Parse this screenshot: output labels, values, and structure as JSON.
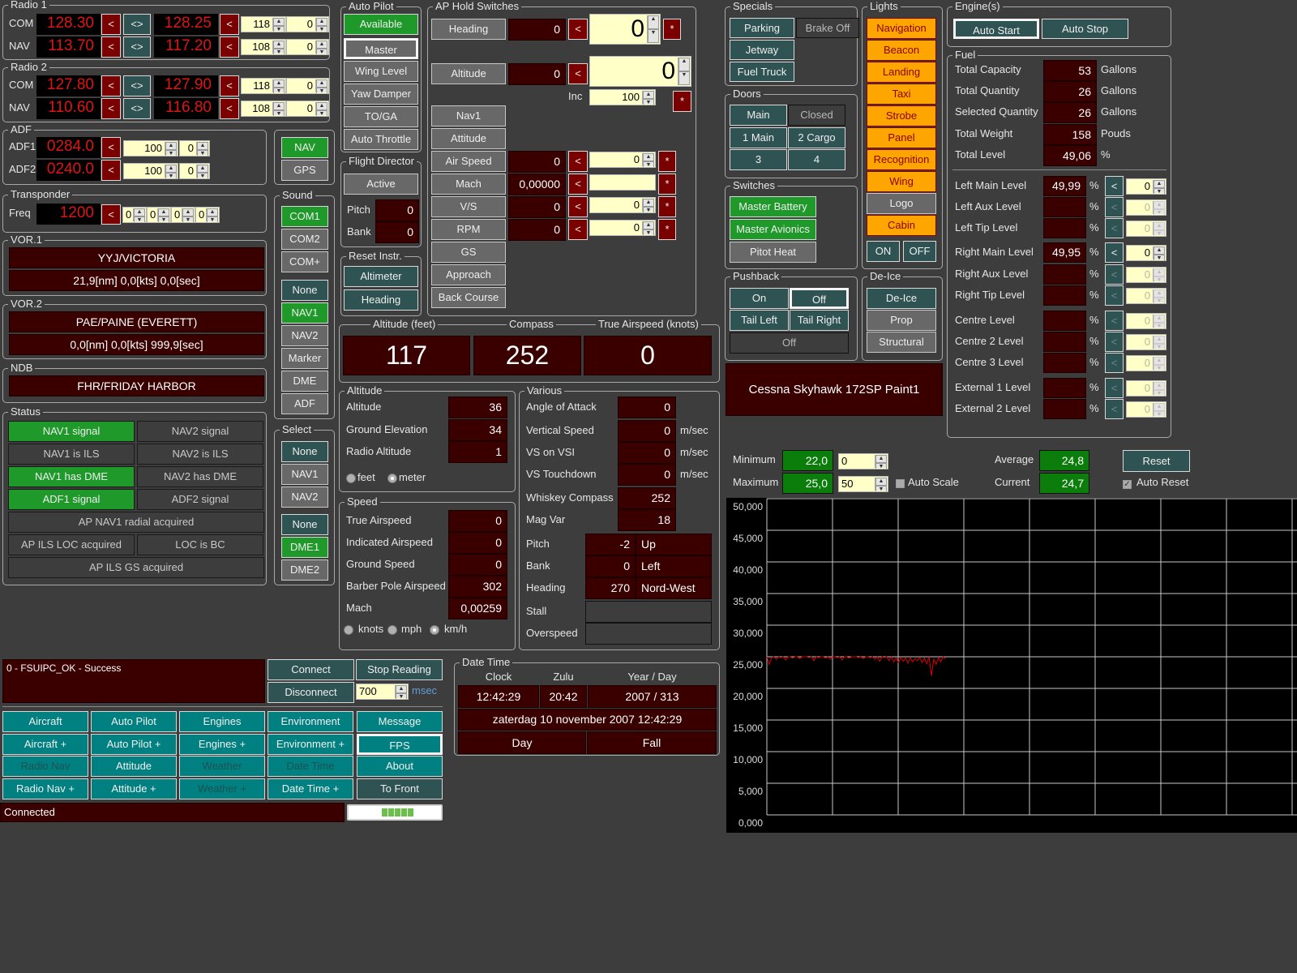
{
  "buttons": {
    "transfer": "<",
    "swap": "<>",
    "set": "*"
  },
  "radio1": {
    "title": "Radio 1",
    "com": {
      "label": "COM",
      "active": "128.30",
      "standby": "128.25",
      "spin_mhz": "118",
      "spin_khz": "0"
    },
    "nav": {
      "label": "NAV",
      "active": "113.70",
      "standby": "117.20",
      "spin_mhz": "108",
      "spin_khz": "0"
    }
  },
  "radio2": {
    "title": "Radio 2",
    "com": {
      "label": "COM",
      "active": "127.80",
      "standby": "127.90",
      "spin_mhz": "118",
      "spin_khz": "0"
    },
    "nav": {
      "label": "NAV",
      "active": "110.60",
      "standby": "116.80",
      "spin_mhz": "108",
      "spin_khz": "0"
    }
  },
  "adf": {
    "title": "ADF",
    "adf1": {
      "label": "ADF1",
      "value": "0284.0",
      "spin1": "100",
      "spin2": "0"
    },
    "adf2": {
      "label": "ADF2",
      "value": "0240.0",
      "spin1": "100",
      "spin2": "0"
    }
  },
  "navgps": {
    "nav": "NAV",
    "gps": "GPS",
    "selected": "NAV"
  },
  "transponder": {
    "title": "Transponder",
    "label": "Freq",
    "value": "1200",
    "digits": [
      "0",
      "0",
      "0",
      "0"
    ]
  },
  "vor1": {
    "title": "VOR.1",
    "ident": "YYJ/VICTORIA",
    "info": "21,9[nm] 0,0[kts] 0,0[sec]"
  },
  "vor2": {
    "title": "VOR.2",
    "ident": "PAE/PAINE (EVERETT)",
    "info": "0,0[nm] 0,0[kts] 999,9[sec]"
  },
  "ndb": {
    "title": "NDB",
    "ident": "FHR/FRIDAY HARBOR"
  },
  "status": {
    "title": "Status",
    "items": [
      {
        "label": "NAV1 signal",
        "on": true
      },
      {
        "label": "NAV2 signal",
        "on": false
      },
      {
        "label": "NAV1 is ILS",
        "on": false
      },
      {
        "label": "NAV2 is ILS",
        "on": false
      },
      {
        "label": "NAV1 has DME",
        "on": true
      },
      {
        "label": "NAV2 has DME",
        "on": false
      },
      {
        "label": "ADF1 signal",
        "on": true
      },
      {
        "label": "ADF2 signal",
        "on": false
      },
      {
        "label": "AP NAV1 radial acquired",
        "on": false
      },
      {
        "label": "AP ILS LOC acquired",
        "on": false
      },
      {
        "label": "LOC is BC",
        "on": false
      },
      {
        "label": "AP ILS GS acquired",
        "on": false
      }
    ]
  },
  "sound": {
    "title": "Sound",
    "items": [
      {
        "label": "COM1",
        "state": "on"
      },
      {
        "label": "COM2",
        "state": "off"
      },
      {
        "label": "COM+",
        "state": "off"
      },
      {
        "label": "None",
        "state": "none"
      },
      {
        "label": "NAV1",
        "state": "on"
      },
      {
        "label": "NAV2",
        "state": "off"
      },
      {
        "label": "Marker",
        "state": "off"
      },
      {
        "label": "DME",
        "state": "off"
      },
      {
        "label": "ADF",
        "state": "off"
      }
    ]
  },
  "select": {
    "title": "Select",
    "items": [
      {
        "label": "None",
        "state": "none"
      },
      {
        "label": "NAV1",
        "state": "off"
      },
      {
        "label": "NAV2",
        "state": "off"
      },
      {
        "label": "None",
        "state": "none"
      },
      {
        "label": "DME1",
        "state": "on"
      },
      {
        "label": "DME2",
        "state": "off"
      }
    ]
  },
  "autopilot": {
    "title": "Auto Pilot",
    "items": [
      {
        "label": "Available",
        "state": "on"
      },
      {
        "label": "Master",
        "state": "off"
      },
      {
        "label": "Wing Level",
        "state": "off"
      },
      {
        "label": "Yaw Damper",
        "state": "off"
      },
      {
        "label": "TO/GA",
        "state": "off"
      },
      {
        "label": "Auto Throttle",
        "state": "off"
      }
    ]
  },
  "flight_director": {
    "title": "Flight Director",
    "active": "Active",
    "pitch_label": "Pitch",
    "pitch": "0",
    "bank_label": "Bank",
    "bank": "0"
  },
  "reset_instr": {
    "title": "Reset Instr.",
    "altimeter": "Altimeter",
    "heading": "Heading"
  },
  "ap_hold": {
    "title": "AP Hold Switches",
    "heading": {
      "label": "Heading",
      "value": "0",
      "set": "0"
    },
    "altitude": {
      "label": "Altitude",
      "value": "0",
      "set": "0"
    },
    "inc_label": "Inc",
    "inc": "100",
    "nav1": "Nav1",
    "attitude": "Attitude",
    "airspeed": {
      "label": "Air Speed",
      "value": "0",
      "set": "0"
    },
    "mach": {
      "label": "Mach",
      "value": "0,00000",
      "set": ""
    },
    "vs": {
      "label": "V/S",
      "value": "0",
      "set": "0"
    },
    "rpm": {
      "label": "RPM",
      "value": "0",
      "set": "0"
    },
    "gs": "GS",
    "approach": "Approach",
    "back_course": "Back Course"
  },
  "instruments": {
    "altitude_label": "Altitude (feet)",
    "altitude": "117",
    "compass_label": "Compass",
    "compass": "252",
    "tas_label": "True Airspeed (knots)",
    "tas": "0"
  },
  "altitude": {
    "title": "Altitude",
    "rows": [
      {
        "label": "Altitude",
        "value": "36"
      },
      {
        "label": "Ground Elevation",
        "value": "34"
      },
      {
        "label": "Radio Altitude",
        "value": "1"
      }
    ],
    "units": [
      {
        "label": "feet",
        "selected": false
      },
      {
        "label": "meter",
        "selected": true
      }
    ]
  },
  "speed": {
    "title": "Speed",
    "rows": [
      {
        "label": "True Airspeed",
        "value": "0"
      },
      {
        "label": "Indicated Airspeed",
        "value": "0"
      },
      {
        "label": "Ground Speed",
        "value": "0"
      },
      {
        "label": "Barber Pole Airspeed",
        "value": "302"
      },
      {
        "label": "Mach",
        "value": "0,00259"
      }
    ],
    "units": [
      {
        "label": "knots",
        "selected": false
      },
      {
        "label": "mph",
        "selected": false
      },
      {
        "label": "km/h",
        "selected": true
      }
    ]
  },
  "various": {
    "title": "Various",
    "rows": [
      {
        "label": "Angle of Attack",
        "value": "0",
        "unit": ""
      },
      {
        "label": "Vertical Speed",
        "value": "0",
        "unit": "m/sec"
      },
      {
        "label": "VS on VSI",
        "value": "0",
        "unit": "m/sec"
      },
      {
        "label": "VS Touchdown",
        "value": "0",
        "unit": "m/sec"
      },
      {
        "label": "Whiskey Compass",
        "value": "252",
        "unit": ""
      },
      {
        "label": "Mag Var",
        "value": "18",
        "unit": ""
      }
    ],
    "attitude": [
      {
        "label": "Pitch",
        "value": "-2",
        "dir": "Up"
      },
      {
        "label": "Bank",
        "value": "0",
        "dir": "Left"
      },
      {
        "label": "Heading",
        "value": "270",
        "dir": "Nord-West"
      }
    ],
    "stall_label": "Stall",
    "overspeed_label": "Overspeed"
  },
  "specials": {
    "title": "Specials",
    "parking": "Parking",
    "brake": "Brake Off",
    "jetway": "Jetway",
    "fuel_truck": "Fuel Truck"
  },
  "doors": {
    "title": "Doors",
    "main": "Main",
    "state": "Closed",
    "d1": "1 Main",
    "d2": "2 Cargo",
    "d3": "3",
    "d4": "4"
  },
  "switches": {
    "title": "Switches",
    "items": [
      {
        "label": "Master Battery",
        "state": "on"
      },
      {
        "label": "Master Avionics",
        "state": "on"
      },
      {
        "label": "Pitot Heat",
        "state": "off"
      }
    ]
  },
  "pushback": {
    "title": "Pushback",
    "on": "On",
    "off": "Off",
    "tail_left": "Tail Left",
    "tail_right": "Tail Right",
    "state": "Off"
  },
  "lights": {
    "title": "Lights",
    "items": [
      {
        "label": "Navigation",
        "on": true
      },
      {
        "label": "Beacon",
        "on": true
      },
      {
        "label": "Landing",
        "on": true
      },
      {
        "label": "Taxi",
        "on": true
      },
      {
        "label": "Strobe",
        "on": true
      },
      {
        "label": "Panel",
        "on": true
      },
      {
        "label": "Recognition",
        "on": true
      },
      {
        "label": "Wing",
        "on": true
      },
      {
        "label": "Logo",
        "on": false
      },
      {
        "label": "Cabin",
        "on": true
      }
    ],
    "all_on": "ON",
    "all_off": "OFF"
  },
  "deice": {
    "title": "De-Ice",
    "items": [
      {
        "label": "De-Ice",
        "state": "none"
      },
      {
        "label": "Prop",
        "state": "off"
      },
      {
        "label": "Structural",
        "state": "off"
      }
    ]
  },
  "aircraft_title": "Cessna Skyhawk 172SP Paint1",
  "engines": {
    "title": "Engine(s)",
    "auto_start": "Auto Start",
    "auto_stop": "Auto Stop"
  },
  "fuel": {
    "title": "Fuel",
    "totals": [
      {
        "label": "Total Capacity",
        "value": "53",
        "unit": "Gallons"
      },
      {
        "label": "Total Quantity",
        "value": "26",
        "unit": "Gallons"
      },
      {
        "label": "Selected Quantity",
        "value": "26",
        "unit": "Gallons"
      },
      {
        "label": "Total Weight",
        "value": "158",
        "unit": "Pouds"
      },
      {
        "label": "Total Level",
        "value": "49,06",
        "unit": "%"
      }
    ],
    "tanks": [
      {
        "label": "Left Main Level",
        "value": "49,99",
        "unit": "%",
        "set": "0",
        "enabled": true
      },
      {
        "label": "Left Aux Level",
        "value": "",
        "unit": "%",
        "set": "0",
        "enabled": false
      },
      {
        "label": "Left Tip Level",
        "value": "",
        "unit": "%",
        "set": "0",
        "enabled": false
      },
      {
        "label": "Right Main Level",
        "value": "49,95",
        "unit": "%",
        "set": "0",
        "enabled": true
      },
      {
        "label": "Right Aux Level",
        "value": "",
        "unit": "%",
        "set": "0",
        "enabled": false
      },
      {
        "label": "Right Tip Level",
        "value": "",
        "unit": "%",
        "set": "0",
        "enabled": false
      },
      {
        "label": "Centre Level",
        "value": "",
        "unit": "%",
        "set": "0",
        "enabled": false
      },
      {
        "label": "Centre 2 Level",
        "value": "",
        "unit": "%",
        "set": "0",
        "enabled": false
      },
      {
        "label": "Centre 3 Level",
        "value": "",
        "unit": "%",
        "set": "0",
        "enabled": false
      },
      {
        "label": "External 1 Level",
        "value": "",
        "unit": "%",
        "set": "0",
        "enabled": false
      },
      {
        "label": "External 2 Level",
        "value": "",
        "unit": "%",
        "set": "0",
        "enabled": false
      }
    ]
  },
  "fps_stats": {
    "minimum_label": "Minimum",
    "minimum": "22,0",
    "min_scale": "0",
    "maximum_label": "Maximum",
    "maximum": "25,0",
    "max_scale": "50",
    "auto_scale_label": "Auto Scale",
    "auto_scale": false,
    "average_label": "Average",
    "average": "24,8",
    "current_label": "Current",
    "current": "24,7",
    "reset": "Reset",
    "auto_reset_label": "Auto Reset",
    "auto_reset": true
  },
  "chart_data": {
    "type": "line",
    "ylim": [
      0,
      50
    ],
    "grid": true,
    "color": "#e00000",
    "yticks": [
      "50,000",
      "45,000",
      "40,000",
      "35,000",
      "30,000",
      "25,000",
      "20,000",
      "15,000",
      "10,000",
      "5,000",
      "0,000"
    ],
    "series": [
      {
        "values": [
          25.0,
          23.8,
          24.9,
          25.0,
          24.6,
          25.0,
          24.9,
          25.0,
          24.5,
          25.0,
          25.0,
          24.8,
          25.0,
          25.0,
          24.7,
          25.0,
          25.0,
          25.0,
          24.9,
          25.0,
          24.4,
          25.0,
          24.9,
          25.0,
          25.0,
          24.8,
          25.0,
          24.6,
          25.0,
          25.0,
          24.9,
          25.0,
          24.5,
          25.0,
          25.0,
          24.8,
          25.0,
          25.0,
          25.0,
          24.9,
          25.0,
          24.7,
          25.0,
          25.0,
          24.9,
          25.0,
          24.6,
          25.0,
          24.3,
          25.0,
          24.9,
          25.0,
          24.4,
          25.0,
          24.2,
          24.8,
          24.1,
          24.9,
          24.3,
          24.8,
          24.0,
          24.9,
          24.2,
          24.7,
          24.4,
          24.9,
          24.1,
          24.8,
          23.9,
          25.0,
          22.0,
          24.6,
          23.8,
          24.9,
          24.2,
          25.0,
          24.7
        ]
      }
    ]
  },
  "connection": {
    "message": "0 - FSUIPC_OK - Success",
    "connect": "Connect",
    "stop_reading": "Stop Reading",
    "disconnect": "Disconnect",
    "interval": "700",
    "interval_unit": "msec"
  },
  "nav_buttons": [
    {
      "label": "Aircraft",
      "style": "normal"
    },
    {
      "label": "Auto Pilot",
      "style": "normal"
    },
    {
      "label": "Engines",
      "style": "normal"
    },
    {
      "label": "Environment",
      "style": "normal"
    },
    {
      "label": "Message",
      "style": "normal"
    },
    {
      "label": "Aircraft +",
      "style": "normal"
    },
    {
      "label": "Auto Pilot +",
      "style": "normal"
    },
    {
      "label": "Engines +",
      "style": "normal"
    },
    {
      "label": "Environment +",
      "style": "normal"
    },
    {
      "label": "FPS",
      "style": "selected"
    },
    {
      "label": "Radio Nav",
      "style": "disabled"
    },
    {
      "label": "Attitude",
      "style": "normal"
    },
    {
      "label": "Weather",
      "style": "disabled"
    },
    {
      "label": "Date Time",
      "style": "disabled"
    },
    {
      "label": "About",
      "style": "normal"
    },
    {
      "label": "Radio Nav +",
      "style": "normal"
    },
    {
      "label": "Attitude +",
      "style": "normal"
    },
    {
      "label": "Weather +",
      "style": "disabled"
    },
    {
      "label": "Date Time +",
      "style": "normal"
    },
    {
      "label": "To Front",
      "style": "dark"
    }
  ],
  "statusbar": {
    "text": "Connected"
  },
  "date_time": {
    "title": "Date Time",
    "clock_label": "Clock",
    "clock": "12:42:29",
    "zulu_label": "Zulu",
    "zulu": "20:42",
    "yearday_label": "Year / Day",
    "yearday": "2007 / 313",
    "long_date": "zaterdag 10 november 2007 12:42:29",
    "day_night": "Day",
    "season": "Fall"
  },
  "colors": {
    "background": "#3d3d3d",
    "lcd_text": "#e01414",
    "value_bg": "#3a0000",
    "active_green": "#1f9a2a",
    "button_teal": "#2f5353",
    "nav_teal": "#008080",
    "light_orange": "#ffa500",
    "chart_line": "#e00000"
  }
}
